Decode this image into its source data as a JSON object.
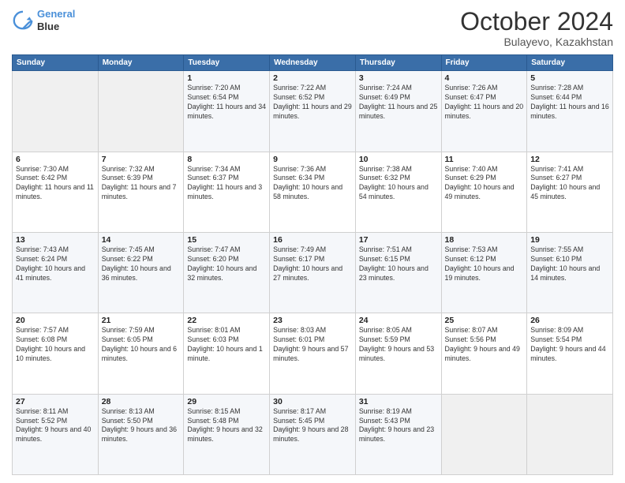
{
  "header": {
    "logo_line1": "General",
    "logo_line2": "Blue",
    "month": "October 2024",
    "location": "Bulayevo, Kazakhstan"
  },
  "weekdays": [
    "Sunday",
    "Monday",
    "Tuesday",
    "Wednesday",
    "Thursday",
    "Friday",
    "Saturday"
  ],
  "weeks": [
    [
      {
        "day": "",
        "sunrise": "",
        "sunset": "",
        "daylight": ""
      },
      {
        "day": "",
        "sunrise": "",
        "sunset": "",
        "daylight": ""
      },
      {
        "day": "1",
        "sunrise": "Sunrise: 7:20 AM",
        "sunset": "Sunset: 6:54 PM",
        "daylight": "Daylight: 11 hours and 34 minutes."
      },
      {
        "day": "2",
        "sunrise": "Sunrise: 7:22 AM",
        "sunset": "Sunset: 6:52 PM",
        "daylight": "Daylight: 11 hours and 29 minutes."
      },
      {
        "day": "3",
        "sunrise": "Sunrise: 7:24 AM",
        "sunset": "Sunset: 6:49 PM",
        "daylight": "Daylight: 11 hours and 25 minutes."
      },
      {
        "day": "4",
        "sunrise": "Sunrise: 7:26 AM",
        "sunset": "Sunset: 6:47 PM",
        "daylight": "Daylight: 11 hours and 20 minutes."
      },
      {
        "day": "5",
        "sunrise": "Sunrise: 7:28 AM",
        "sunset": "Sunset: 6:44 PM",
        "daylight": "Daylight: 11 hours and 16 minutes."
      }
    ],
    [
      {
        "day": "6",
        "sunrise": "Sunrise: 7:30 AM",
        "sunset": "Sunset: 6:42 PM",
        "daylight": "Daylight: 11 hours and 11 minutes."
      },
      {
        "day": "7",
        "sunrise": "Sunrise: 7:32 AM",
        "sunset": "Sunset: 6:39 PM",
        "daylight": "Daylight: 11 hours and 7 minutes."
      },
      {
        "day": "8",
        "sunrise": "Sunrise: 7:34 AM",
        "sunset": "Sunset: 6:37 PM",
        "daylight": "Daylight: 11 hours and 3 minutes."
      },
      {
        "day": "9",
        "sunrise": "Sunrise: 7:36 AM",
        "sunset": "Sunset: 6:34 PM",
        "daylight": "Daylight: 10 hours and 58 minutes."
      },
      {
        "day": "10",
        "sunrise": "Sunrise: 7:38 AM",
        "sunset": "Sunset: 6:32 PM",
        "daylight": "Daylight: 10 hours and 54 minutes."
      },
      {
        "day": "11",
        "sunrise": "Sunrise: 7:40 AM",
        "sunset": "Sunset: 6:29 PM",
        "daylight": "Daylight: 10 hours and 49 minutes."
      },
      {
        "day": "12",
        "sunrise": "Sunrise: 7:41 AM",
        "sunset": "Sunset: 6:27 PM",
        "daylight": "Daylight: 10 hours and 45 minutes."
      }
    ],
    [
      {
        "day": "13",
        "sunrise": "Sunrise: 7:43 AM",
        "sunset": "Sunset: 6:24 PM",
        "daylight": "Daylight: 10 hours and 41 minutes."
      },
      {
        "day": "14",
        "sunrise": "Sunrise: 7:45 AM",
        "sunset": "Sunset: 6:22 PM",
        "daylight": "Daylight: 10 hours and 36 minutes."
      },
      {
        "day": "15",
        "sunrise": "Sunrise: 7:47 AM",
        "sunset": "Sunset: 6:20 PM",
        "daylight": "Daylight: 10 hours and 32 minutes."
      },
      {
        "day": "16",
        "sunrise": "Sunrise: 7:49 AM",
        "sunset": "Sunset: 6:17 PM",
        "daylight": "Daylight: 10 hours and 27 minutes."
      },
      {
        "day": "17",
        "sunrise": "Sunrise: 7:51 AM",
        "sunset": "Sunset: 6:15 PM",
        "daylight": "Daylight: 10 hours and 23 minutes."
      },
      {
        "day": "18",
        "sunrise": "Sunrise: 7:53 AM",
        "sunset": "Sunset: 6:12 PM",
        "daylight": "Daylight: 10 hours and 19 minutes."
      },
      {
        "day": "19",
        "sunrise": "Sunrise: 7:55 AM",
        "sunset": "Sunset: 6:10 PM",
        "daylight": "Daylight: 10 hours and 14 minutes."
      }
    ],
    [
      {
        "day": "20",
        "sunrise": "Sunrise: 7:57 AM",
        "sunset": "Sunset: 6:08 PM",
        "daylight": "Daylight: 10 hours and 10 minutes."
      },
      {
        "day": "21",
        "sunrise": "Sunrise: 7:59 AM",
        "sunset": "Sunset: 6:05 PM",
        "daylight": "Daylight: 10 hours and 6 minutes."
      },
      {
        "day": "22",
        "sunrise": "Sunrise: 8:01 AM",
        "sunset": "Sunset: 6:03 PM",
        "daylight": "Daylight: 10 hours and 1 minute."
      },
      {
        "day": "23",
        "sunrise": "Sunrise: 8:03 AM",
        "sunset": "Sunset: 6:01 PM",
        "daylight": "Daylight: 9 hours and 57 minutes."
      },
      {
        "day": "24",
        "sunrise": "Sunrise: 8:05 AM",
        "sunset": "Sunset: 5:59 PM",
        "daylight": "Daylight: 9 hours and 53 minutes."
      },
      {
        "day": "25",
        "sunrise": "Sunrise: 8:07 AM",
        "sunset": "Sunset: 5:56 PM",
        "daylight": "Daylight: 9 hours and 49 minutes."
      },
      {
        "day": "26",
        "sunrise": "Sunrise: 8:09 AM",
        "sunset": "Sunset: 5:54 PM",
        "daylight": "Daylight: 9 hours and 44 minutes."
      }
    ],
    [
      {
        "day": "27",
        "sunrise": "Sunrise: 8:11 AM",
        "sunset": "Sunset: 5:52 PM",
        "daylight": "Daylight: 9 hours and 40 minutes."
      },
      {
        "day": "28",
        "sunrise": "Sunrise: 8:13 AM",
        "sunset": "Sunset: 5:50 PM",
        "daylight": "Daylight: 9 hours and 36 minutes."
      },
      {
        "day": "29",
        "sunrise": "Sunrise: 8:15 AM",
        "sunset": "Sunset: 5:48 PM",
        "daylight": "Daylight: 9 hours and 32 minutes."
      },
      {
        "day": "30",
        "sunrise": "Sunrise: 8:17 AM",
        "sunset": "Sunset: 5:45 PM",
        "daylight": "Daylight: 9 hours and 28 minutes."
      },
      {
        "day": "31",
        "sunrise": "Sunrise: 8:19 AM",
        "sunset": "Sunset: 5:43 PM",
        "daylight": "Daylight: 9 hours and 23 minutes."
      },
      {
        "day": "",
        "sunrise": "",
        "sunset": "",
        "daylight": ""
      },
      {
        "day": "",
        "sunrise": "",
        "sunset": "",
        "daylight": ""
      }
    ]
  ]
}
